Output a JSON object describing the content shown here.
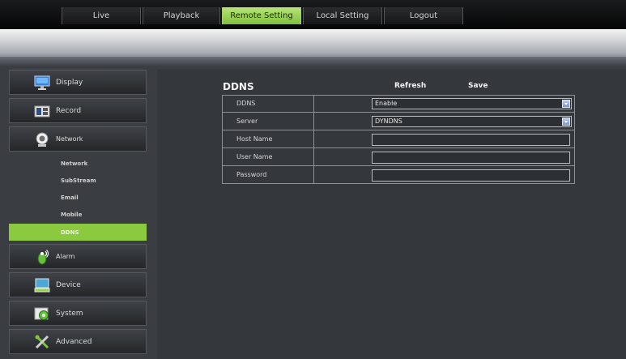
{
  "nav": {
    "tabs": [
      {
        "label": "Live"
      },
      {
        "label": "Playback"
      },
      {
        "label": "Remote Setting",
        "active": true
      },
      {
        "label": "Local Setting"
      },
      {
        "label": "Logout"
      }
    ]
  },
  "sidebar": {
    "items": [
      {
        "label": "Display",
        "icon": "monitor-icon"
      },
      {
        "label": "Record",
        "icon": "record-icon"
      },
      {
        "label": "Network",
        "icon": "network-icon"
      },
      {
        "label": "Alarm",
        "icon": "alarm-icon"
      },
      {
        "label": "Device",
        "icon": "device-icon"
      },
      {
        "label": "System",
        "icon": "system-icon"
      },
      {
        "label": "Advanced",
        "icon": "advanced-icon"
      }
    ],
    "network_sub": [
      {
        "label": "Network"
      },
      {
        "label": "SubStream"
      },
      {
        "label": "Email"
      },
      {
        "label": "Mobile"
      },
      {
        "label": "DDNS",
        "active": true
      }
    ]
  },
  "panel": {
    "title": "DDNS",
    "refresh_label": "Refresh",
    "save_label": "Save",
    "fields": {
      "ddns": {
        "label": "DDNS",
        "value": "Enable"
      },
      "server": {
        "label": "Server",
        "value": "DYNDNS"
      },
      "host_name": {
        "label": "Host Name",
        "value": ""
      },
      "user_name": {
        "label": "User Name",
        "value": ""
      },
      "password": {
        "label": "Password",
        "value": ""
      }
    }
  },
  "colors": {
    "accent": "#8bc93f",
    "background": "#3a3d42"
  }
}
